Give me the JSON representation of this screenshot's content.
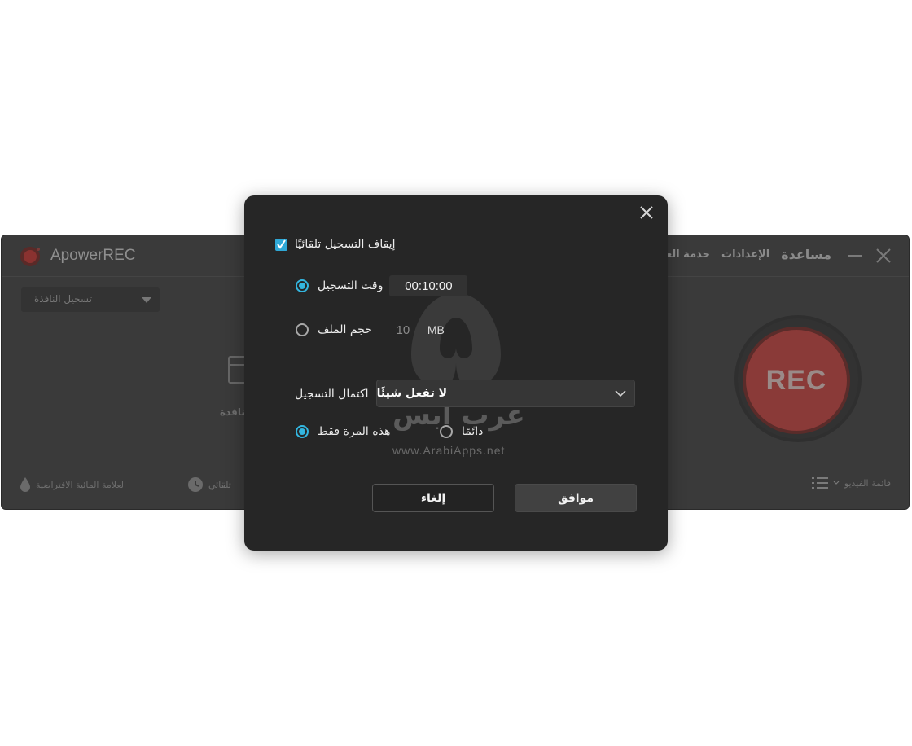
{
  "app": {
    "name": "ApowerREC",
    "menu": [
      "مساعدة",
      "الإعدادات",
      "خدمة العملاء"
    ],
    "mode_select": "تسجيل النافذة",
    "window_label": "النافذة",
    "rec_label": "REC",
    "footer": {
      "watermark_label": "العلامة المائية الافتراضية",
      "auto_label": "تلقائي",
      "video_list_label": "قائمة الفيديو"
    },
    "colors": {
      "window_bg": "#3a3a3a",
      "rec_red": "#8a3a38"
    }
  },
  "dialog": {
    "auto_stop_label": "إيقاف التسجيل تلقائيًا",
    "auto_stop_checked": true,
    "record_time": {
      "label": "وقت التسجيل",
      "value": "00:10:00",
      "selected": true
    },
    "file_size": {
      "label": "حجم الملف",
      "value": "10",
      "unit": "MB",
      "selected": false
    },
    "on_complete": {
      "label": "اكتمال التسجيل",
      "selected_option": "لا تفعل شيئًا"
    },
    "scope": {
      "this_time": {
        "label": "هذه المرة فقط",
        "selected": true
      },
      "always": {
        "label": "دائمًا",
        "selected": false
      }
    },
    "cancel_label": "إلغاء",
    "ok_label": "موافق",
    "watermark": {
      "arabic": "عرب ابس",
      "site": "www.ArabiApps.net"
    },
    "colors": {
      "accent": "#33b6e0",
      "dialog_bg": "#262626"
    }
  }
}
